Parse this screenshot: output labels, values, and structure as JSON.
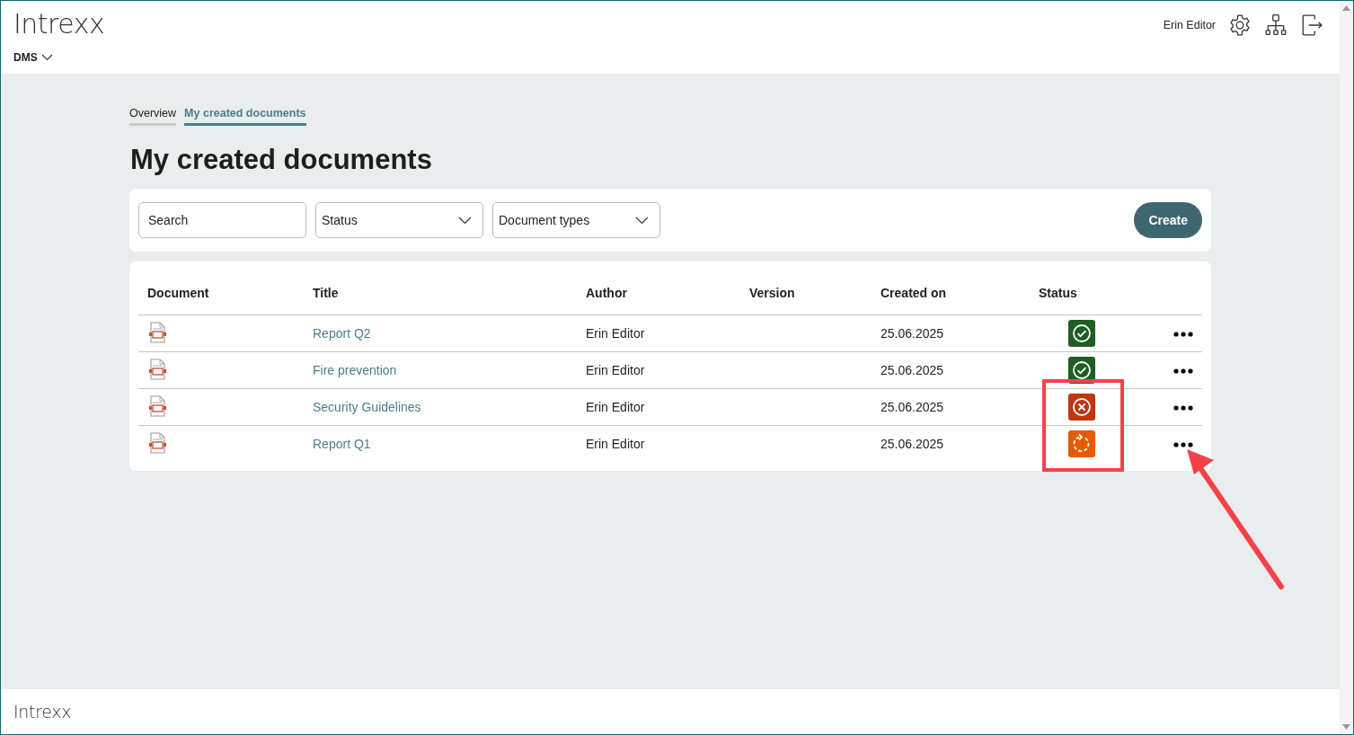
{
  "header": {
    "logo": "Intrexx",
    "app_menu": "DMS",
    "user": "Erin Editor"
  },
  "tabs": [
    {
      "label": "Overview",
      "selected": false
    },
    {
      "label": "My created documents",
      "selected": true
    }
  ],
  "page_title": "My created documents",
  "filters": {
    "search": {
      "placeholder": "Search"
    },
    "status": {
      "placeholder": "Status"
    },
    "document_types": {
      "placeholder": "Document types"
    },
    "create_button": "Create"
  },
  "table": {
    "columns": [
      "Document",
      "Title",
      "Author",
      "Version",
      "Created on",
      "Status"
    ],
    "rows": [
      {
        "title": "Report Q2",
        "author": "Erin Editor",
        "created_on": "25.06.2025",
        "kind": "approved"
      },
      {
        "title": "Fire prevention",
        "author": "Erin Editor",
        "created_on": "25.06.2025",
        "kind": "approved"
      },
      {
        "title": "Security Guidelines",
        "author": "Erin Editor",
        "created_on": "25.06.2025",
        "kind": "rejected"
      },
      {
        "title": "Report Q1",
        "author": "Erin Editor",
        "created_on": "25.06.2025",
        "kind": "pending"
      }
    ]
  },
  "footer": {
    "logo": "Intrexx"
  }
}
